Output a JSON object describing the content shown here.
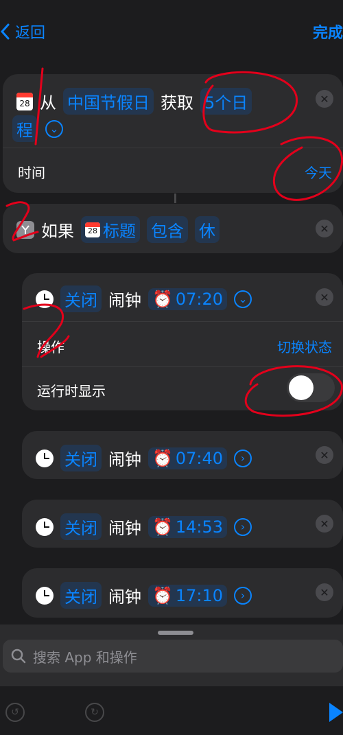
{
  "nav": {
    "back_label": "返回",
    "done_label": "完成"
  },
  "calendar_icon_day": "28",
  "get_action": {
    "from": "从",
    "source": "中国节假日",
    "get": "获取",
    "count": "5个日",
    "count_cont": "程",
    "time_label": "时间",
    "time_value": "今天"
  },
  "if_action": {
    "if_label": "如果",
    "field": "标题",
    "operator": "包含",
    "value": "休"
  },
  "alarm_actions": [
    {
      "action": "关闭",
      "noun": "闹钟",
      "time": "07:20",
      "expanded": true
    },
    {
      "action": "关闭",
      "noun": "闹钟",
      "time": "07:40",
      "expanded": false
    },
    {
      "action": "关闭",
      "noun": "闹钟",
      "time": "14:53",
      "expanded": false
    },
    {
      "action": "关闭",
      "noun": "闹钟",
      "time": "17:10",
      "expanded": false
    }
  ],
  "alarm_details": {
    "operation_label": "操作",
    "operation_value": "切换状态",
    "show_label": "运行时显示",
    "show_toggle": false
  },
  "search": {
    "placeholder": "搜索 App 和操作"
  },
  "colors": {
    "accent": "#0a84ff",
    "background": "#1c1c1e",
    "card": "#2c2c2e",
    "annotation": "#e3001b"
  },
  "icons": [
    "chevron-left-icon",
    "calendar-icon",
    "branch-icon",
    "clock-icon",
    "alarm-icon",
    "close-icon",
    "search-icon",
    "undo-icon",
    "redo-icon",
    "play-icon"
  ]
}
